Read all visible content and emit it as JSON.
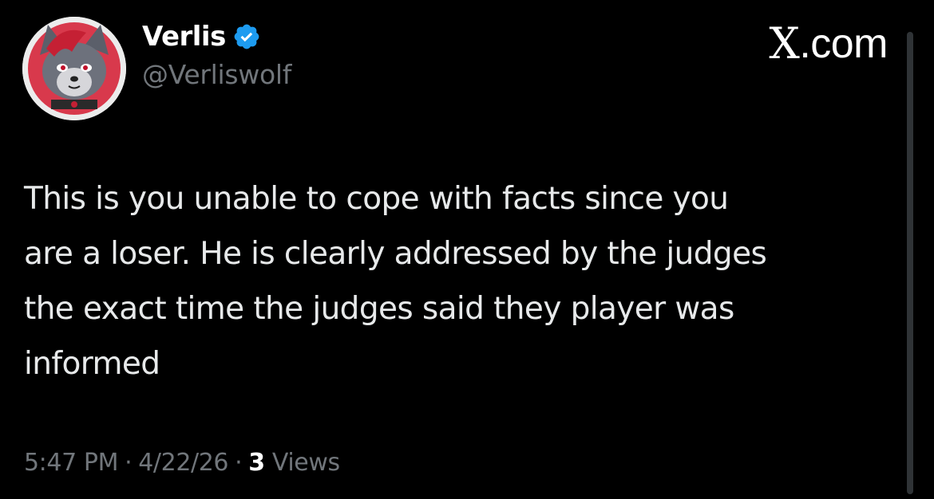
{
  "user": {
    "display_name": "Verlis",
    "handle": "@Verliswolf",
    "verified": true,
    "verified_color": "#1d9bf0",
    "avatar_icon": "wolf-avatar"
  },
  "brand": {
    "x_letter": "X",
    "domain": ".com"
  },
  "tweet": {
    "text": "This is you unable to cope with facts since you\nare a loser. He is clearly addressed by the judges\nthe exact time the judges said they player was\ninformed"
  },
  "meta": {
    "time": "5:47 PM",
    "separator": "·",
    "date": "4/22/26",
    "views_count": "3",
    "views_label": "Views"
  },
  "colors": {
    "background": "#000000",
    "primary_text": "#e7e9ea",
    "secondary_text": "#71767b"
  }
}
